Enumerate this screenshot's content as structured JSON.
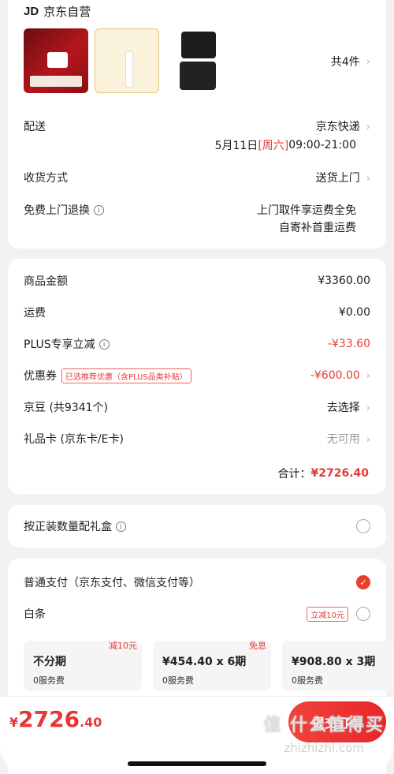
{
  "store": {
    "name": "京东自营",
    "logo": "JD"
  },
  "goods": {
    "count_label": "共4件",
    "thumbs": [
      "cosmetics-gift-set",
      "skinceuticals-product",
      "black-vanity-case"
    ]
  },
  "delivery": {
    "label": "配送",
    "carrier": "京东快递",
    "date": "5月11日",
    "weekday": "[周六]",
    "time": "09:00-21:00"
  },
  "receive": {
    "label": "收货方式",
    "value": "送货上门"
  },
  "returns": {
    "label": "免费上门退换",
    "line1": "上门取件享运费全免",
    "line2": "自寄补首重运费"
  },
  "amounts": {
    "goods_label": "商品金额",
    "goods_value": "¥3360.00",
    "shipping_label": "运费",
    "shipping_value": "¥0.00",
    "plus_label": "PLUS专享立减",
    "plus_value": "-¥33.60",
    "coupon_label": "优惠券",
    "coupon_tag": "已选推荐优惠（含PLUS品类补贴）",
    "coupon_value": "-¥600.00",
    "jingdou_label": "京豆 (共9341个)",
    "jingdou_value": "去选择",
    "giftcard_label": "礼品卡 (京东卡/E卡)",
    "giftcard_value": "无可用",
    "total_label": "合计：",
    "total_value": "¥2726.40"
  },
  "giftbox": {
    "label": "按正装数量配礼盒"
  },
  "payment": {
    "normal_label": "普通支付（京东支付、微信支付等）",
    "baitiao_label": "白条",
    "baitiao_tag": "立减10元",
    "plans": [
      {
        "title": "不分期",
        "fee": "0服务费",
        "corner": "减10元"
      },
      {
        "title": "¥454.40 x 6期",
        "fee": "0服务费",
        "corner": "免息"
      },
      {
        "title": "¥908.80 x 3期",
        "fee": "0服务费",
        "corner": ""
      }
    ]
  },
  "footer": {
    "currency": "¥",
    "integer": "2726",
    "decimal": ".40",
    "submit_label": "提交订单",
    "watermark": "值 什么值得买",
    "watermark_url": "zhizhizhi.com"
  },
  "colors": {
    "accent": "#e53935",
    "background": "#f2f2f2"
  }
}
